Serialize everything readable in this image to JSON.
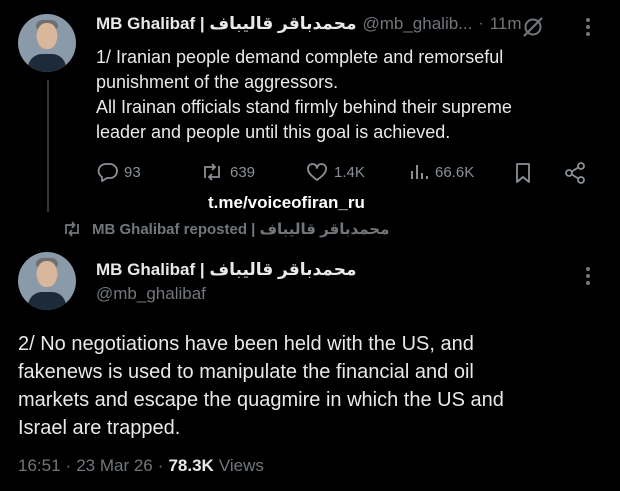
{
  "tweet1": {
    "display_name": "MB Ghalibaf | محمدباقر قالیباف",
    "handle": "@mb_ghalib...",
    "separator": "·",
    "time": "11m",
    "lines": [
      "1/ Iranian people demand complete and remorseful",
      "punishment of the aggressors.",
      "All Irainan officials stand firmly behind their supreme",
      "leader and people until this goal is achieved."
    ],
    "actions": {
      "replies": "93",
      "reposts": "639",
      "likes": "1.4K",
      "views": "66.6K"
    }
  },
  "watermark": "t.me/voiceofiran_ru",
  "repost_banner": {
    "text": "MB Ghalibaf reposted | محمدباقر قالیباف"
  },
  "tweet2": {
    "display_name": "MB Ghalibaf | محمدباقر قالیباف",
    "handle": "@mb_ghalibaf",
    "lines": [
      "2/ No negotiations have been held with the US, and",
      "fakenews is used to manipulate the financial and oil",
      "markets and escape the quagmire in which the US and",
      "Israel are trapped."
    ],
    "time": "16:51",
    "date": "23 Mar 26",
    "views_count": "78.3K",
    "views_label": "Views",
    "sep": "·"
  },
  "icons": [
    "grok-icon",
    "more-icon",
    "reply-icon",
    "repost-icon",
    "like-icon",
    "views-icon",
    "bookmark-icon",
    "share-icon"
  ]
}
